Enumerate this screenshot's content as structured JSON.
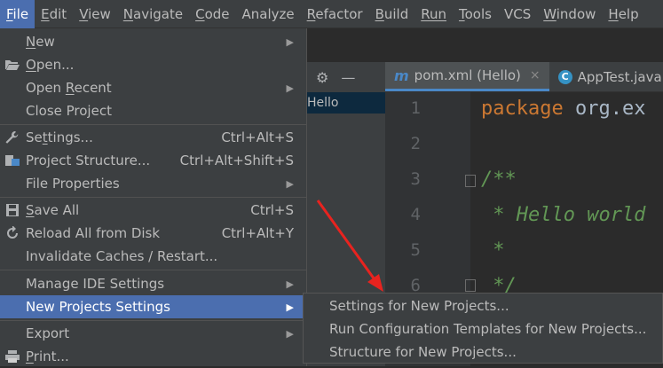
{
  "menubar": {
    "items": [
      {
        "label": "File",
        "u": "F",
        "rest": "ile"
      },
      {
        "label": "Edit",
        "u": "E",
        "rest": "dit"
      },
      {
        "label": "View",
        "u": "V",
        "rest": "iew"
      },
      {
        "label": "Navigate",
        "u": "N",
        "rest": "avigate"
      },
      {
        "label": "Code",
        "u": "C",
        "rest": "ode"
      },
      {
        "label": "Analyze",
        "u": "",
        "rest": "Analyze"
      },
      {
        "label": "Refactor",
        "u": "R",
        "rest": "efactor"
      },
      {
        "label": "Build",
        "u": "B",
        "rest": "uild"
      },
      {
        "label": "Run",
        "u": "",
        "rest": "Run"
      },
      {
        "label": "Tools",
        "u": "T",
        "rest": "ools"
      },
      {
        "label": "VCS",
        "u": "",
        "rest": "VCS"
      },
      {
        "label": "Window",
        "u": "W",
        "rest": "indow"
      },
      {
        "label": "Help",
        "u": "H",
        "rest": "elp"
      }
    ]
  },
  "project": {
    "selected": "Hello"
  },
  "tabs": [
    {
      "icon": "m",
      "label": "pom.xml (Hello)",
      "close": "×"
    },
    {
      "icon": "C",
      "label": "AppTest.java"
    }
  ],
  "editor": {
    "line_numbers": [
      "1",
      "2",
      "3",
      "4",
      "5",
      "6"
    ],
    "lines": {
      "l1_kw": "package",
      "l1_rest": " org.ex",
      "l3": "/**",
      "l4": " * Hello world",
      "l5": " *",
      "l6": " */"
    }
  },
  "file_menu": {
    "new": {
      "pre": "",
      "u": "N",
      "post": "ew"
    },
    "open": {
      "pre": "",
      "u": "O",
      "post": "pen..."
    },
    "open_recent": {
      "pre": "Open ",
      "u": "R",
      "post": "ecent"
    },
    "close_project": {
      "pre": "Close Project",
      "u": "",
      "post": ""
    },
    "settings": {
      "pre": "Se",
      "u": "t",
      "post": "tings...",
      "shortcut": "Ctrl+Alt+S"
    },
    "project_structure": {
      "pre": "Project Structure...",
      "u": "",
      "post": "",
      "shortcut": "Ctrl+Alt+Shift+S"
    },
    "file_properties": {
      "pre": "File Properties",
      "u": "",
      "post": ""
    },
    "save_all": {
      "pre": "",
      "u": "S",
      "post": "ave All",
      "shortcut": "Ctrl+S"
    },
    "reload": {
      "pre": "Reload All from Disk",
      "u": "",
      "post": "",
      "shortcut": "Ctrl+Alt+Y"
    },
    "invalidate": {
      "pre": "Invalidate Caches / Restart...",
      "u": "",
      "post": ""
    },
    "manage_ide": {
      "pre": "Manage IDE Settings",
      "u": "",
      "post": ""
    },
    "new_projects_settings": {
      "pre": "New Projects Settings",
      "u": "",
      "post": ""
    },
    "export": {
      "pre": "Export",
      "u": "",
      "post": ""
    },
    "print": {
      "pre": "",
      "u": "P",
      "post": "rint..."
    }
  },
  "submenu": {
    "items": [
      "Settings for New Projects...",
      "Run Configuration Templates for New Projects...",
      "Structure for New Projects..."
    ]
  },
  "colors": {
    "accent": "#4b6eaf",
    "arrow": "#e8231f",
    "menu_bg": "#3c3f41",
    "editor_bg": "#2b2b2b"
  },
  "icons": [
    "folder-open-icon",
    "wrench-icon",
    "project-structure-icon",
    "save-icon",
    "reload-icon",
    "printer-icon",
    "gear-icon",
    "minimize-icon",
    "submenu-arrow-icon"
  ]
}
